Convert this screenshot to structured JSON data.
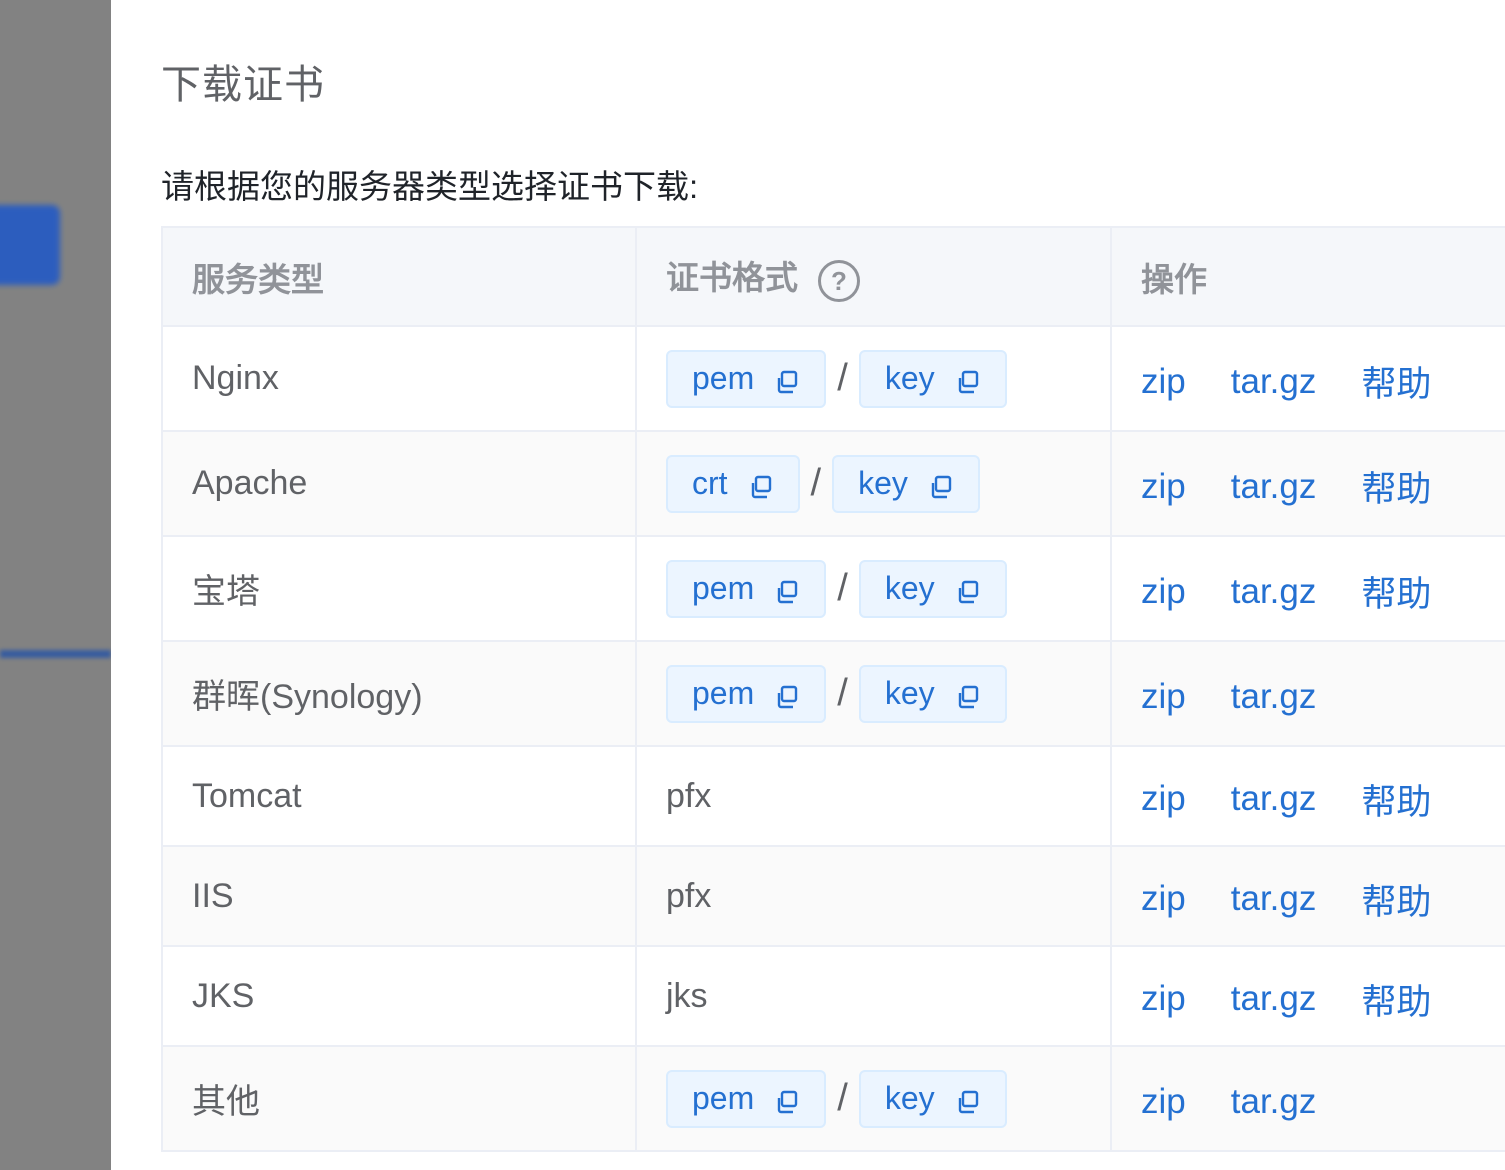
{
  "drawer": {
    "title": "下载证书",
    "intro": "请根据您的服务器类型选择证书下载:"
  },
  "table": {
    "headers": {
      "service_type": "服务类型",
      "cert_format": "证书格式",
      "actions": "操作"
    },
    "rows": [
      {
        "service": "Nginx",
        "tags": [
          "pem",
          "key"
        ],
        "format_text": null,
        "actions": [
          "zip",
          "tar.gz",
          "帮助"
        ]
      },
      {
        "service": "Apache",
        "tags": [
          "crt",
          "key"
        ],
        "format_text": null,
        "actions": [
          "zip",
          "tar.gz",
          "帮助"
        ]
      },
      {
        "service": "宝塔",
        "tags": [
          "pem",
          "key"
        ],
        "format_text": null,
        "actions": [
          "zip",
          "tar.gz",
          "帮助"
        ]
      },
      {
        "service": "群晖(Synology)",
        "tags": [
          "pem",
          "key"
        ],
        "format_text": null,
        "actions": [
          "zip",
          "tar.gz"
        ]
      },
      {
        "service": "Tomcat",
        "tags": [],
        "format_text": "pfx",
        "actions": [
          "zip",
          "tar.gz",
          "帮助"
        ]
      },
      {
        "service": "IIS",
        "tags": [],
        "format_text": "pfx",
        "actions": [
          "zip",
          "tar.gz",
          "帮助"
        ]
      },
      {
        "service": "JKS",
        "tags": [],
        "format_text": "jks",
        "actions": [
          "zip",
          "tar.gz",
          "帮助"
        ]
      },
      {
        "service": "其他",
        "tags": [
          "pem",
          "key"
        ],
        "format_text": null,
        "actions": [
          "zip",
          "tar.gz"
        ]
      }
    ],
    "separator": "/"
  },
  "icons": {
    "header_help": "question-circle-icon",
    "tag_copy": "copy-icon"
  },
  "colors": {
    "link": "#2470d1",
    "tag_bg": "#ecf5ff",
    "tag_border": "#d9ecff",
    "header_bg": "#f5f7fa"
  }
}
